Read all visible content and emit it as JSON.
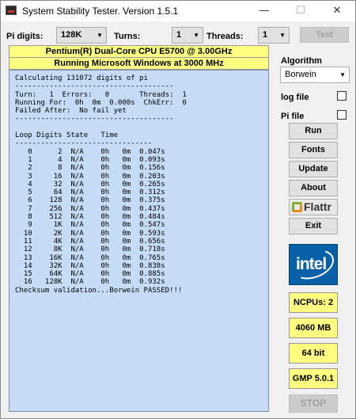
{
  "window": {
    "title": "System Stability Tester. Version 1.5.1",
    "controls": {
      "minimize": "—",
      "maximize": "☐",
      "close": "✕"
    }
  },
  "toolbar": {
    "pi_digits_label": "Pi digits:",
    "pi_digits_value": "128K",
    "turns_label": "Turns:",
    "turns_value": "1",
    "threads_label": "Threads:",
    "threads_value": "1",
    "test_label": "Test",
    "dropdown_arrow": "▼"
  },
  "header": {
    "cpu_line": "Pentium(R) Dual-Core  CPU      E5700  @ 3.00GHz",
    "os_line": "Running Microsoft Windows at 3000 MHz"
  },
  "console": {
    "lines": [
      "Calculating 131072 digits of pi",
      "-------------------------------------",
      "Turn:   1  Errors:   0       Threads:  1",
      "Running For:  0h  0m  0.000s  ChkErr:  0",
      "Failed After:  No fail yet",
      "-------------------------------------",
      "",
      "Loop Digits State   Time",
      "--------------------------------",
      "   0      2  N/A    0h   0m  0.047s",
      "   1      4  N/A    0h   0m  0.093s",
      "   2      8  N/A    0h   0m  0.156s",
      "   3     16  N/A    0h   0m  0.203s",
      "   4     32  N/A    0h   0m  0.265s",
      "   5     64  N/A    0h   0m  0.312s",
      "   6    128  N/A    0h   0m  0.375s",
      "   7    256  N/A    0h   0m  0.437s",
      "   8    512  N/A    0h   0m  0.484s",
      "   9     1K  N/A    0h   0m  0.547s",
      "  10     2K  N/A    0h   0m  0.593s",
      "  11     4K  N/A    0h   0m  0.656s",
      "  12     8K  N/A    0h   0m  0.718s",
      "  13    16K  N/A    0h   0m  0.765s",
      "  14    32K  N/A    0h   0m  0.838s",
      "  15    64K  N/A    0h   0m  0.885s",
      "  16   128K  N/A    0h   0m  0.932s",
      "Checksum validation...Borwein PASSED!!!"
    ]
  },
  "sidebar": {
    "algorithm_label": "Algorithm",
    "algorithm_value": "Borwein",
    "log_file_label": "log file",
    "pi_file_label": "Pi file",
    "run_label": "Run",
    "fonts_label": "Fonts",
    "update_label": "Update",
    "about_label": "About",
    "flattr_label": "Flattr",
    "exit_label": "Exit",
    "intel_logo": "intel",
    "ncpus": "NCPUs: 2",
    "memory": "4060 MB",
    "bits": "64 bit",
    "gmp": "GMP 5.0.1",
    "stop_label": "STOP"
  },
  "colors": {
    "console_bg": "#c6dcf6",
    "info_bg": "#ffff80",
    "intel_blue": "#0860a8"
  }
}
